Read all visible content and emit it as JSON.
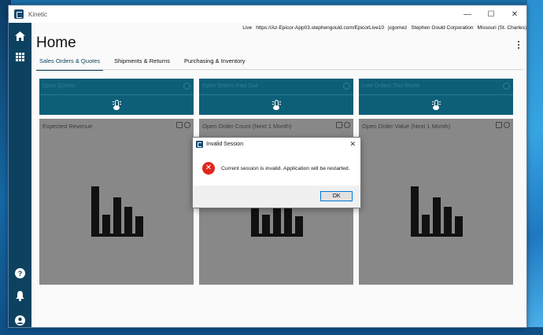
{
  "window": {
    "app_title": "Kinetic",
    "controls": {
      "minimize": "—",
      "maximize": "☐",
      "close": "✕"
    }
  },
  "infobar": {
    "environment": "Live",
    "server_url": "https://Az-Epicor-App03.stephengould.com/EpicorLive10",
    "user": "jcgomez",
    "company": "Stephen Gould Corporation",
    "site": "Missouri (St. Charles)"
  },
  "header": {
    "title": "Home"
  },
  "tabs": [
    {
      "label": "Sales Orders & Quotes",
      "active": true
    },
    {
      "label": "Shipments & Returns",
      "active": false
    },
    {
      "label": "Purchasing & Inventory",
      "active": false
    }
  ],
  "kpi_tiles": [
    {
      "title": "Open Quotes"
    },
    {
      "title": "Open Orders Past Due"
    },
    {
      "title": "Late Orders This Month"
    }
  ],
  "widgets": [
    {
      "title": "Expected Revenue"
    },
    {
      "title": "Open Order Count (Next 1 Month)"
    },
    {
      "title": "Open Order Value (Next 1 Month)"
    }
  ],
  "dialog": {
    "title": "Invalid Session",
    "message": "Current session is invalid. Application will be restarted.",
    "ok_label": "OK",
    "error_color": "#e1261c"
  },
  "sidebar": {
    "icons": [
      "home-icon",
      "apps-grid-icon",
      "help-icon",
      "notifications-icon",
      "user-account-icon"
    ]
  }
}
